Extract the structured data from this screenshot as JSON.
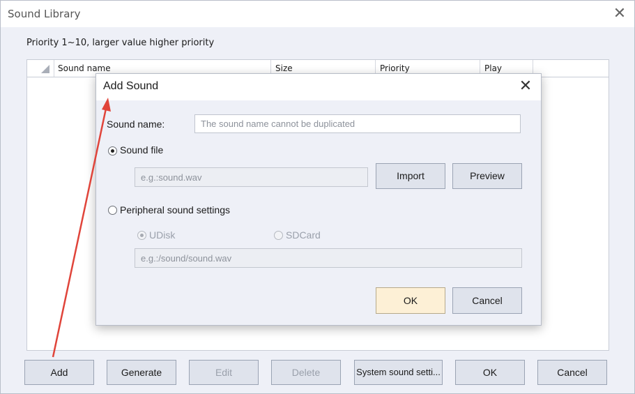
{
  "window": {
    "title": "Sound Library",
    "close_glyph": "✕"
  },
  "priority_note": "Priority 1~10, larger value higher priority",
  "table": {
    "columns": [
      "Sound name",
      "Size",
      "Priority",
      "Play"
    ],
    "rows": []
  },
  "bottom_buttons": {
    "add": "Add",
    "generate": "Generate",
    "edit": "Edit",
    "delete": "Delete",
    "system_sound": "System sound setti...",
    "ok": "OK",
    "cancel": "Cancel"
  },
  "dialog": {
    "title": "Add Sound",
    "close_glyph": "✕",
    "sound_name_label": "Sound name:",
    "sound_name_placeholder": "The sound name cannot be duplicated",
    "sound_file": {
      "label": "Sound file",
      "selected": true
    },
    "file_path_placeholder": "e.g.:sound.wav",
    "import_label": "Import",
    "preview_label": "Preview",
    "peripheral": {
      "label": "Peripheral sound settings",
      "selected": false
    },
    "udisk_label": "UDisk",
    "sdcard_label": "SDCard",
    "peripheral_path_placeholder": "e.g.:/sound/sound.wav",
    "ok_label": "OK",
    "cancel_label": "Cancel"
  },
  "colors": {
    "annotation_arrow": "#e0443a",
    "primary_button_bg": "#fdf0d6",
    "window_bg": "#eef0f7"
  }
}
